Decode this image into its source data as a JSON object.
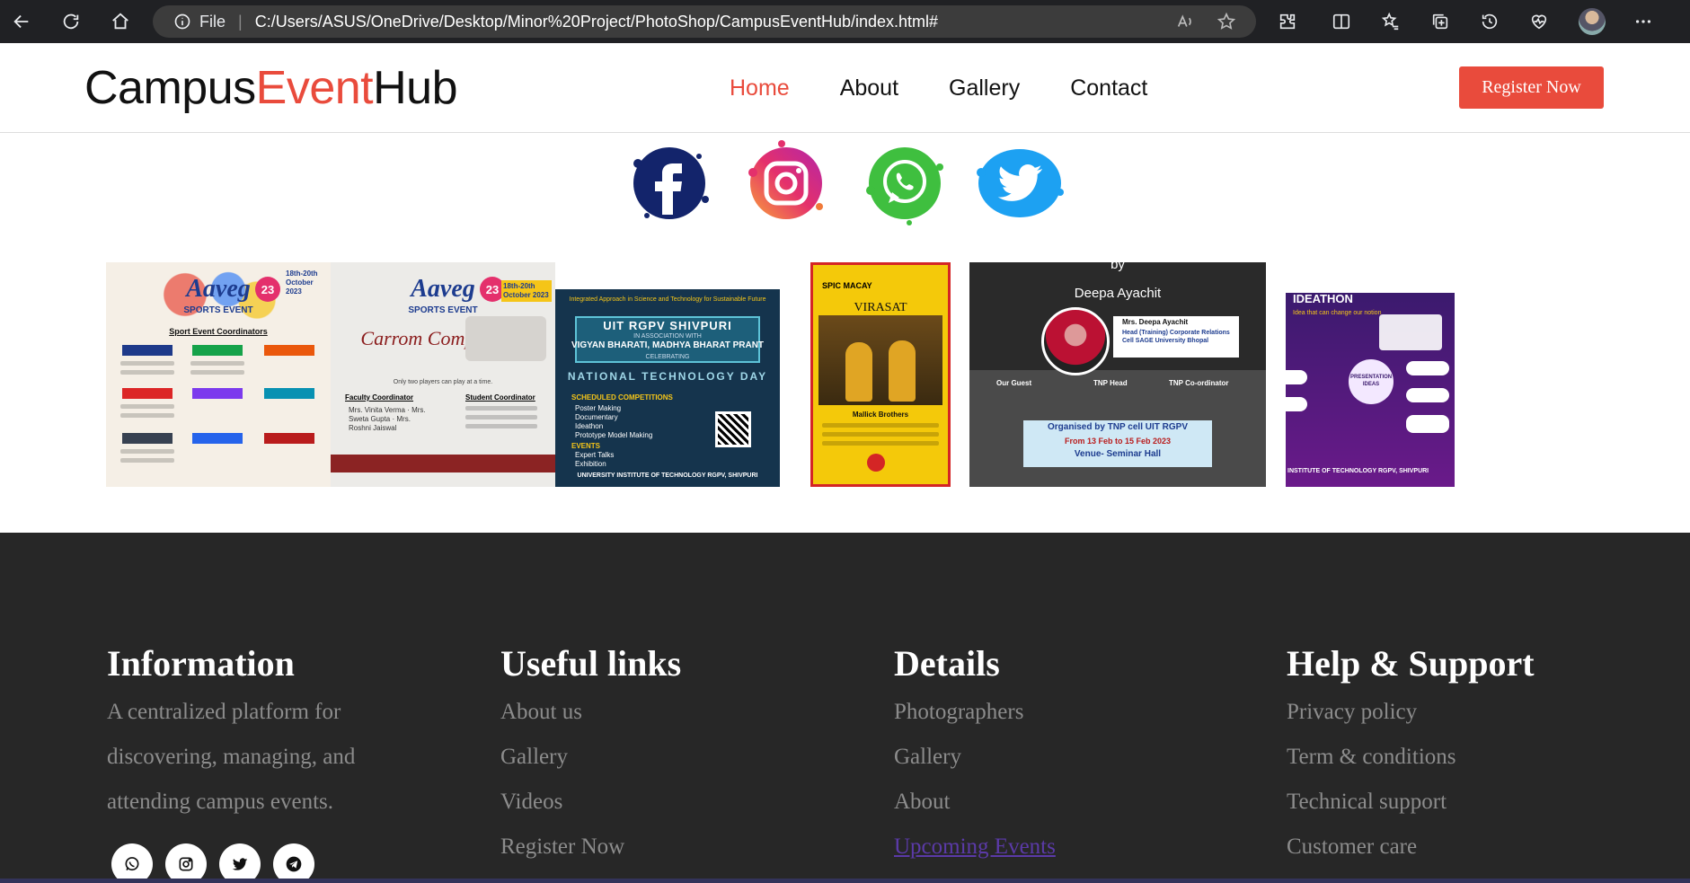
{
  "browser": {
    "file_label": "File",
    "url": "C:/Users/ASUS/OneDrive/Desktop/Minor%20Project/PhotoShop/CampusEventHub/index.html#"
  },
  "header": {
    "logo_part1": "Campus",
    "logo_part2": "Event",
    "logo_part3": "Hub",
    "menu": [
      "Home",
      "About",
      "Gallery",
      "Contact"
    ],
    "register_label": "Register Now",
    "accent": "#e94b3c"
  },
  "socials": [
    "facebook-icon",
    "instagram-icon",
    "whatsapp-icon",
    "twitter-icon"
  ],
  "gallery": {
    "posters": [
      {
        "title": "Aaveg",
        "badge": "23",
        "subtitle": "SPORTS EVENT",
        "dates": "18th-20th October 2023",
        "heading": "Sport Event Coordinators"
      },
      {
        "title": "Aaveg",
        "badge": "23",
        "subtitle": "SPORTS EVENT",
        "dates": "18th-20th October 2023",
        "heading": "Carrom Competition",
        "note": "Only two players can play at a time.",
        "left_head": "Faculty Coordinator",
        "left_names": "Mrs. Vinita Verma · Mrs. Sweta Gupta · Mrs. Roshni Jaiswal",
        "right_head": "Student Coordinator"
      },
      {
        "tagline": "Integrated Approach in Science and Technology for Sustainable Future",
        "title": "UIT RGPV SHIVPURI",
        "subtitle": "IN ASSOCIATION WITH",
        "partner": "VIGYAN BHARATI, MADHYA BHARAT PRANT",
        "celebrating": "CELEBRATING",
        "event": "NATIONAL TECHNOLOGY DAY",
        "section1": "SCHEDULED COMPETITIONS",
        "items": [
          "Poster Making",
          "Documentary",
          "Ideathon",
          "Prototype Model Making"
        ],
        "section2": "EVENTS",
        "items2": [
          "Expert Talks",
          "Exhibition"
        ],
        "footer": "UNIVERSITY INSTITUTE OF TECHNOLOGY RGPV, SHIVPURI"
      },
      {
        "brand": "SPIC MACAY",
        "title": "VIRASAT",
        "names": "Mallick Brothers"
      },
      {
        "top": "by",
        "name": "Deepa Ayachit",
        "role": "Mrs. Deepa Ayachit",
        "desc": "Head (Training) Corporate Relations Cell SAGE University Bhopal",
        "guest": "Our Guest",
        "tnp_head": "TNP Head",
        "tnp_coord": "TNP Co-ordinator",
        "organised": "Organised by TNP cell UIT RGPV",
        "dates": "From 13 Feb to 15 Feb 2023",
        "venue": "Venue- Seminar Hall"
      },
      {
        "title": "IDEATHON",
        "tag": "Idea that can change our notion",
        "center": "PRESENTATION IDEAS",
        "footer": "INSTITUTE OF TECHNOLOGY RGPV, SHIVPURI"
      }
    ]
  },
  "footer": {
    "cols": [
      {
        "title": "Information",
        "lines": [
          "A centralized platform for",
          "discovering, managing, and",
          "attending campus events."
        ]
      },
      {
        "title": "Useful links",
        "lines": [
          "About us",
          "Gallery",
          "Videos",
          "Register Now"
        ]
      },
      {
        "title": "Details",
        "lines": [
          "Photographers",
          "Gallery",
          "About",
          "Upcoming Events"
        ]
      },
      {
        "title": "Help & Support",
        "lines": [
          "Privacy policy",
          "Term & conditions",
          "Technical support",
          "Customer care"
        ]
      }
    ],
    "social_icons": [
      "whatsapp-icon",
      "instagram-icon",
      "twitter-icon",
      "telegram-icon"
    ],
    "bg": "#272727",
    "link_visited": "#5b3aa8"
  }
}
